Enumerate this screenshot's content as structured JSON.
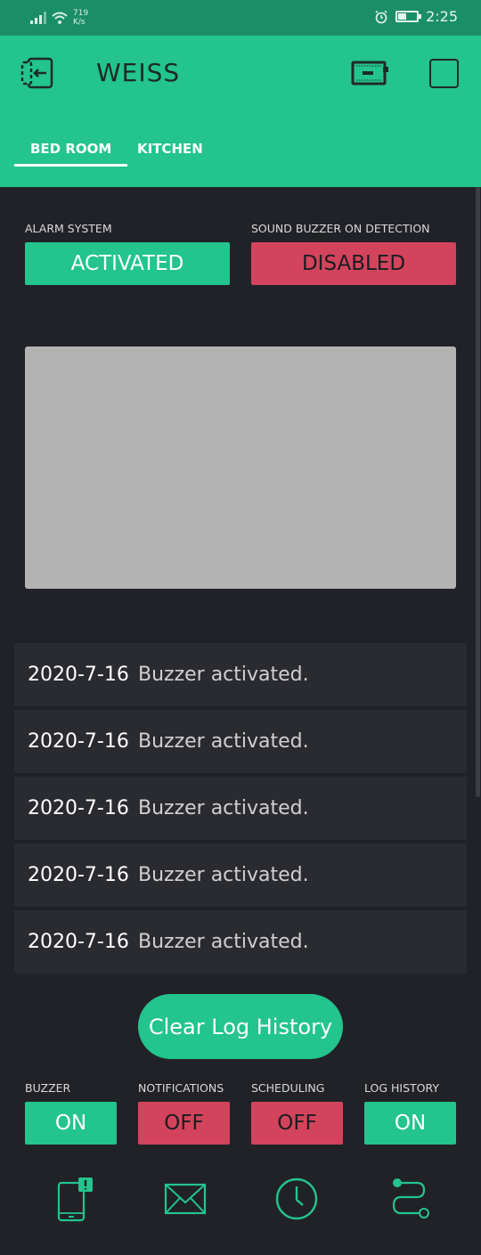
{
  "status": {
    "speed_value": "719",
    "speed_unit": "K/s",
    "time": "2:25",
    "battery_level": 0.45
  },
  "header": {
    "title": "WEISS",
    "tabs": [
      {
        "label": "BED ROOM",
        "active": true
      },
      {
        "label": "KITCHEN",
        "active": false
      }
    ]
  },
  "alarm": {
    "label": "ALARM SYSTEM",
    "value": "ACTIVATED"
  },
  "sound_buzzer": {
    "label": "SOUND BUZZER ON DETECTION",
    "value": "DISABLED"
  },
  "log": [
    {
      "date": "2020-7-16",
      "message": "Buzzer activated."
    },
    {
      "date": "2020-7-16",
      "message": "Buzzer activated."
    },
    {
      "date": "2020-7-16",
      "message": "Buzzer activated."
    },
    {
      "date": "2020-7-16",
      "message": "Buzzer activated."
    },
    {
      "date": "2020-7-16",
      "message": "Buzzer activated."
    }
  ],
  "clear_button": "Clear Log History",
  "switches": [
    {
      "label": "BUZZER",
      "value": "ON"
    },
    {
      "label": "NOTIFICATIONS",
      "value": "OFF"
    },
    {
      "label": "SCHEDULING",
      "value": "OFF"
    },
    {
      "label": "LOG HISTORY",
      "value": "ON"
    }
  ],
  "bottom_icons": [
    "phone-alert-icon",
    "mail-icon",
    "clock-icon",
    "route-icon"
  ],
  "colors": {
    "accent_green": "#23c48e",
    "alert_red": "#d3435c",
    "background": "#212227",
    "video_placeholder": "#b3b3b3"
  }
}
